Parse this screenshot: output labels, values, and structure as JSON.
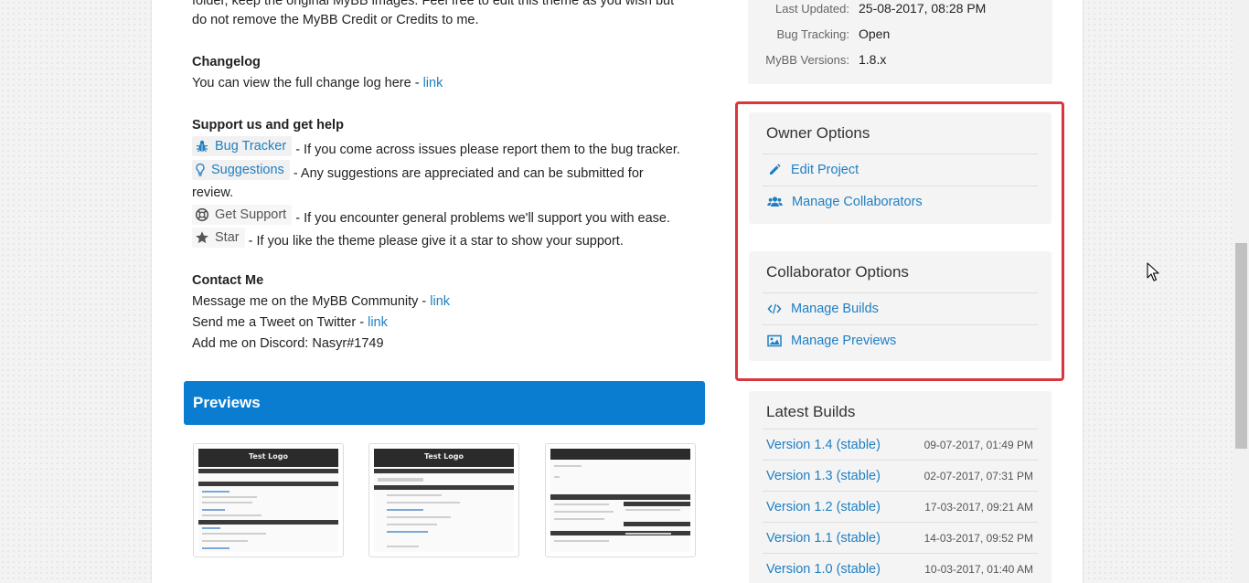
{
  "description": {
    "intro_line1": "folder, keep the original MyBB images. Feel free to edit this theme as you wish but",
    "intro_line2": "do not remove the MyBB Credit or Credits to me.",
    "changelog_heading": "Changelog",
    "changelog_text": "You can view the full change log here - ",
    "changelog_link": "link",
    "support_heading": "Support us and get help",
    "bug_tracker_label": "Bug Tracker",
    "bug_tracker_text": " - If you come across issues please report them to the bug tracker.",
    "suggestions_label": "Suggestions",
    "suggestions_text": " - Any suggestions are appreciated and can be submitted for",
    "suggestions_text2": "review.",
    "get_support_label": "Get Support",
    "get_support_text": " - If you encounter general problems we'll support you with ease.",
    "star_label": "Star",
    "star_text": " - If you like the theme please give it a star to show your support.",
    "contact_heading": "Contact Me",
    "contact_mybb_text": "Message me on the MyBB Community - ",
    "contact_mybb_link": "link",
    "contact_twitter_text": "Send me a Tweet on Twitter - ",
    "contact_twitter_link": "link",
    "contact_discord_text": "Add me on Discord: Nasyr#1749"
  },
  "previews": {
    "title": "Previews",
    "thumb_logo": "Test Logo"
  },
  "info": {
    "last_updated_label": "Last Updated:",
    "last_updated_value": "25-08-2017, 08:28 PM",
    "bug_tracking_label": "Bug Tracking:",
    "bug_tracking_value": "Open",
    "mybb_versions_label": "MyBB Versions:",
    "mybb_versions_value": "1.8.x"
  },
  "owner_options": {
    "title": "Owner Options",
    "edit_project": "Edit Project",
    "manage_collaborators": "Manage Collaborators"
  },
  "collaborator_options": {
    "title": "Collaborator Options",
    "manage_builds": "Manage Builds",
    "manage_previews": "Manage Previews"
  },
  "latest_builds": {
    "title": "Latest Builds",
    "items": [
      {
        "version": "Version 1.4 (stable)",
        "date": "09-07-2017, 01:49 PM"
      },
      {
        "version": "Version 1.3 (stable)",
        "date": "02-07-2017, 07:31 PM"
      },
      {
        "version": "Version 1.2 (stable)",
        "date": "17-03-2017, 09:21 AM"
      },
      {
        "version": "Version 1.1 (stable)",
        "date": "14-03-2017, 09:52 PM"
      },
      {
        "version": "Version 1.0 (stable)",
        "date": "10-03-2017, 01:40 AM"
      }
    ]
  },
  "colors": {
    "link": "#1f7fc1",
    "previews_bar": "#0b7dd1",
    "highlight_border": "#d9363e",
    "panel_bg": "#f4f4f5"
  },
  "icons": [
    "bug-icon",
    "lightbulb-icon",
    "lifebuoy-icon",
    "star-icon",
    "pencil-icon",
    "users-icon",
    "code-icon",
    "image-icon",
    "mouse-cursor-icon"
  ]
}
